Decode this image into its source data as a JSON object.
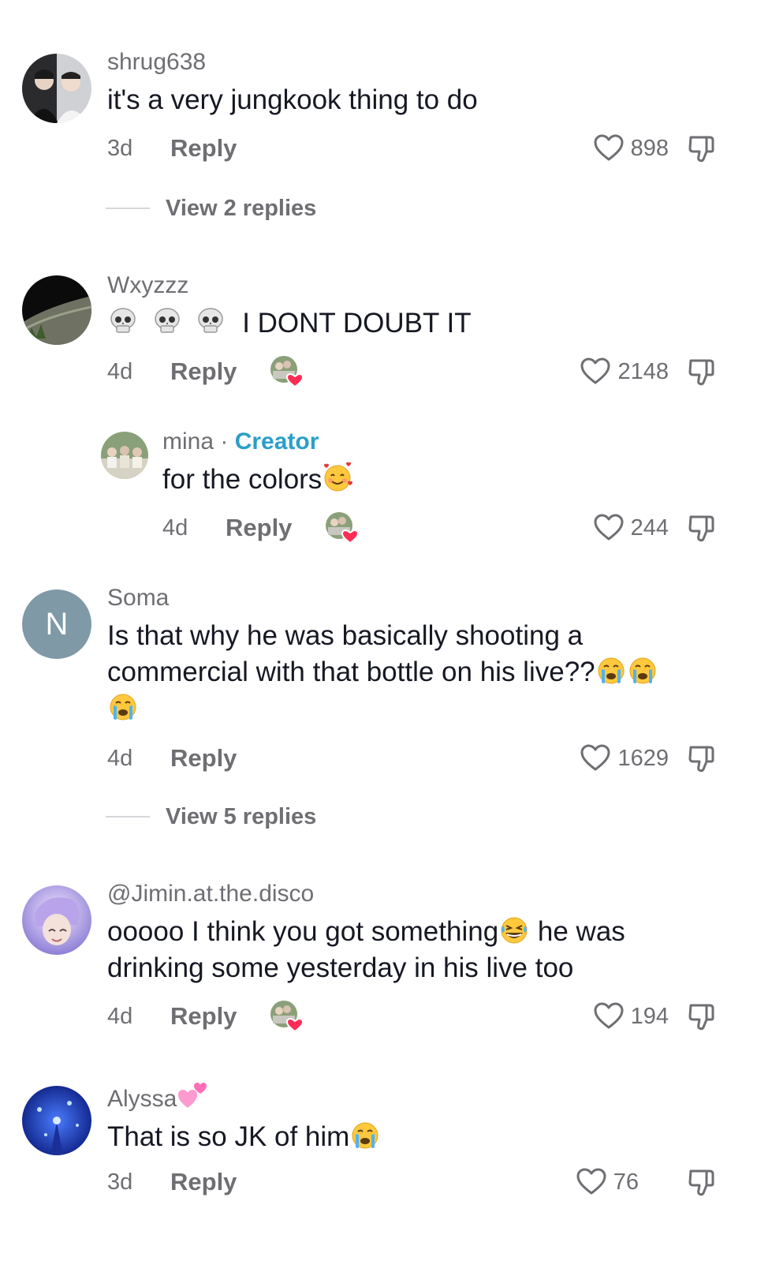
{
  "comments": [
    {
      "username": "shrug638",
      "text": "it's a very jungkook thing to do",
      "age": "3d",
      "reply_label": "Reply",
      "likes": "898",
      "view_replies": "View 2 replies"
    },
    {
      "username": "Wxyzzz",
      "text": "I DONT DOUBT IT",
      "emoji_prefix": [
        "skull-emoji",
        "skull-emoji",
        "skull-emoji"
      ],
      "age": "4d",
      "reply_label": "Reply",
      "likes": "2148",
      "liked_by_creator": true
    },
    {
      "username": "mina",
      "creator_badge": "Creator",
      "separator": "·",
      "text": "for the colors",
      "emoji_suffix": [
        "smiling-hearts-emoji"
      ],
      "age": "4d",
      "reply_label": "Reply",
      "likes": "244",
      "liked_by_creator": true,
      "is_reply": true
    },
    {
      "username": "Soma",
      "avatar_letter": "N",
      "text_line1": "Is that why he was basically shooting a",
      "text_line2": "commercial with that bottle on his live??",
      "emoji_suffix": [
        "crying-emoji",
        "crying-emoji",
        "crying-emoji"
      ],
      "age": "4d",
      "reply_label": "Reply",
      "likes": "1629",
      "view_replies": "View 5 replies"
    },
    {
      "username": "@Jimin.at.the.disco",
      "text_line1_a": "ooooo I think you got something",
      "text_line1_b": " he was",
      "text_line2": "drinking some yesterday in his live too",
      "emoji_inline": [
        "laughing-emoji"
      ],
      "age": "4d",
      "reply_label": "Reply",
      "likes": "194",
      "liked_by_creator": true
    },
    {
      "username": "Alyssa",
      "username_emoji": "two-hearts-emoji",
      "text": "That is so JK of him",
      "emoji_suffix": [
        "crying-emoji"
      ],
      "age": "3d",
      "reply_label": "Reply",
      "likes": "76"
    }
  ],
  "colors": {
    "text": "#161823",
    "muted": "#6e6e73",
    "creator": "#2a9fc9",
    "heart_badge": "#fe2c55"
  },
  "icons": [
    "heart-icon",
    "dislike-icon",
    "liked-by-creator-icon"
  ]
}
